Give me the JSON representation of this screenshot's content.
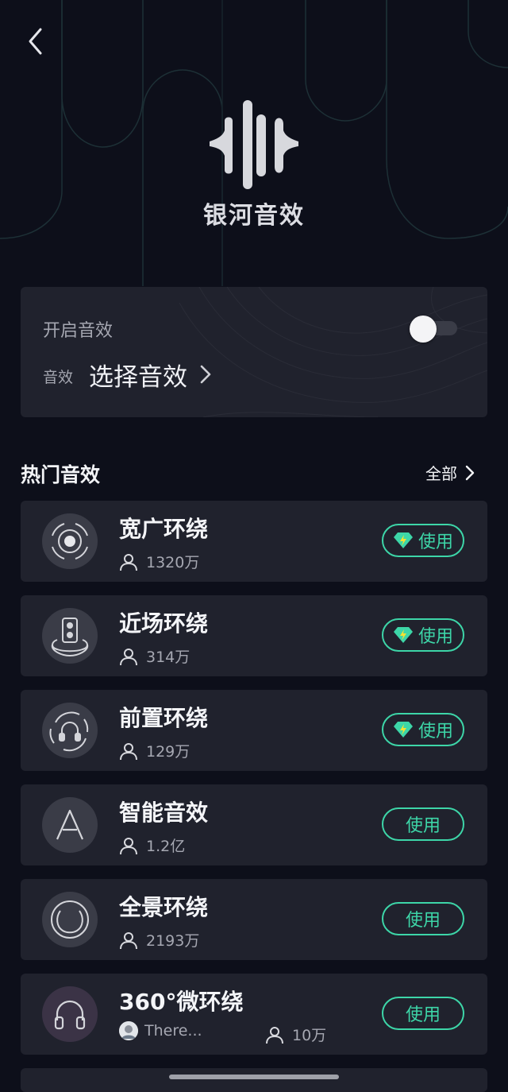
{
  "header": {
    "brand_name": "银河音效"
  },
  "control": {
    "enable_label": "开启音效",
    "enabled": true,
    "effect_label": "音效",
    "select_label": "选择音效"
  },
  "section": {
    "title": "热门音效",
    "see_all_label": "全部"
  },
  "effects": [
    {
      "name": "宽广环绕",
      "users": "1320万",
      "button": "使用",
      "vip": true,
      "icon": "wide-surround-icon"
    },
    {
      "name": "近场环绕",
      "users": "314万",
      "button": "使用",
      "vip": true,
      "icon": "speaker-icon"
    },
    {
      "name": "前置环绕",
      "users": "129万",
      "button": "使用",
      "vip": true,
      "icon": "headphone-surround-icon"
    },
    {
      "name": "智能音效",
      "users": "1.2亿",
      "button": "使用",
      "vip": false,
      "icon": "letter-a-icon"
    },
    {
      "name": "全景环绕",
      "users": "2193万",
      "button": "使用",
      "vip": false,
      "icon": "panorama-icon"
    },
    {
      "name": "360°微环绕",
      "creator": "There...",
      "users": "10万",
      "button": "使用",
      "vip": false,
      "icon": "headphones-icon"
    }
  ],
  "colors": {
    "background": "#0d0f1a",
    "card": "#20222d",
    "accent": "#3dd6a8"
  }
}
